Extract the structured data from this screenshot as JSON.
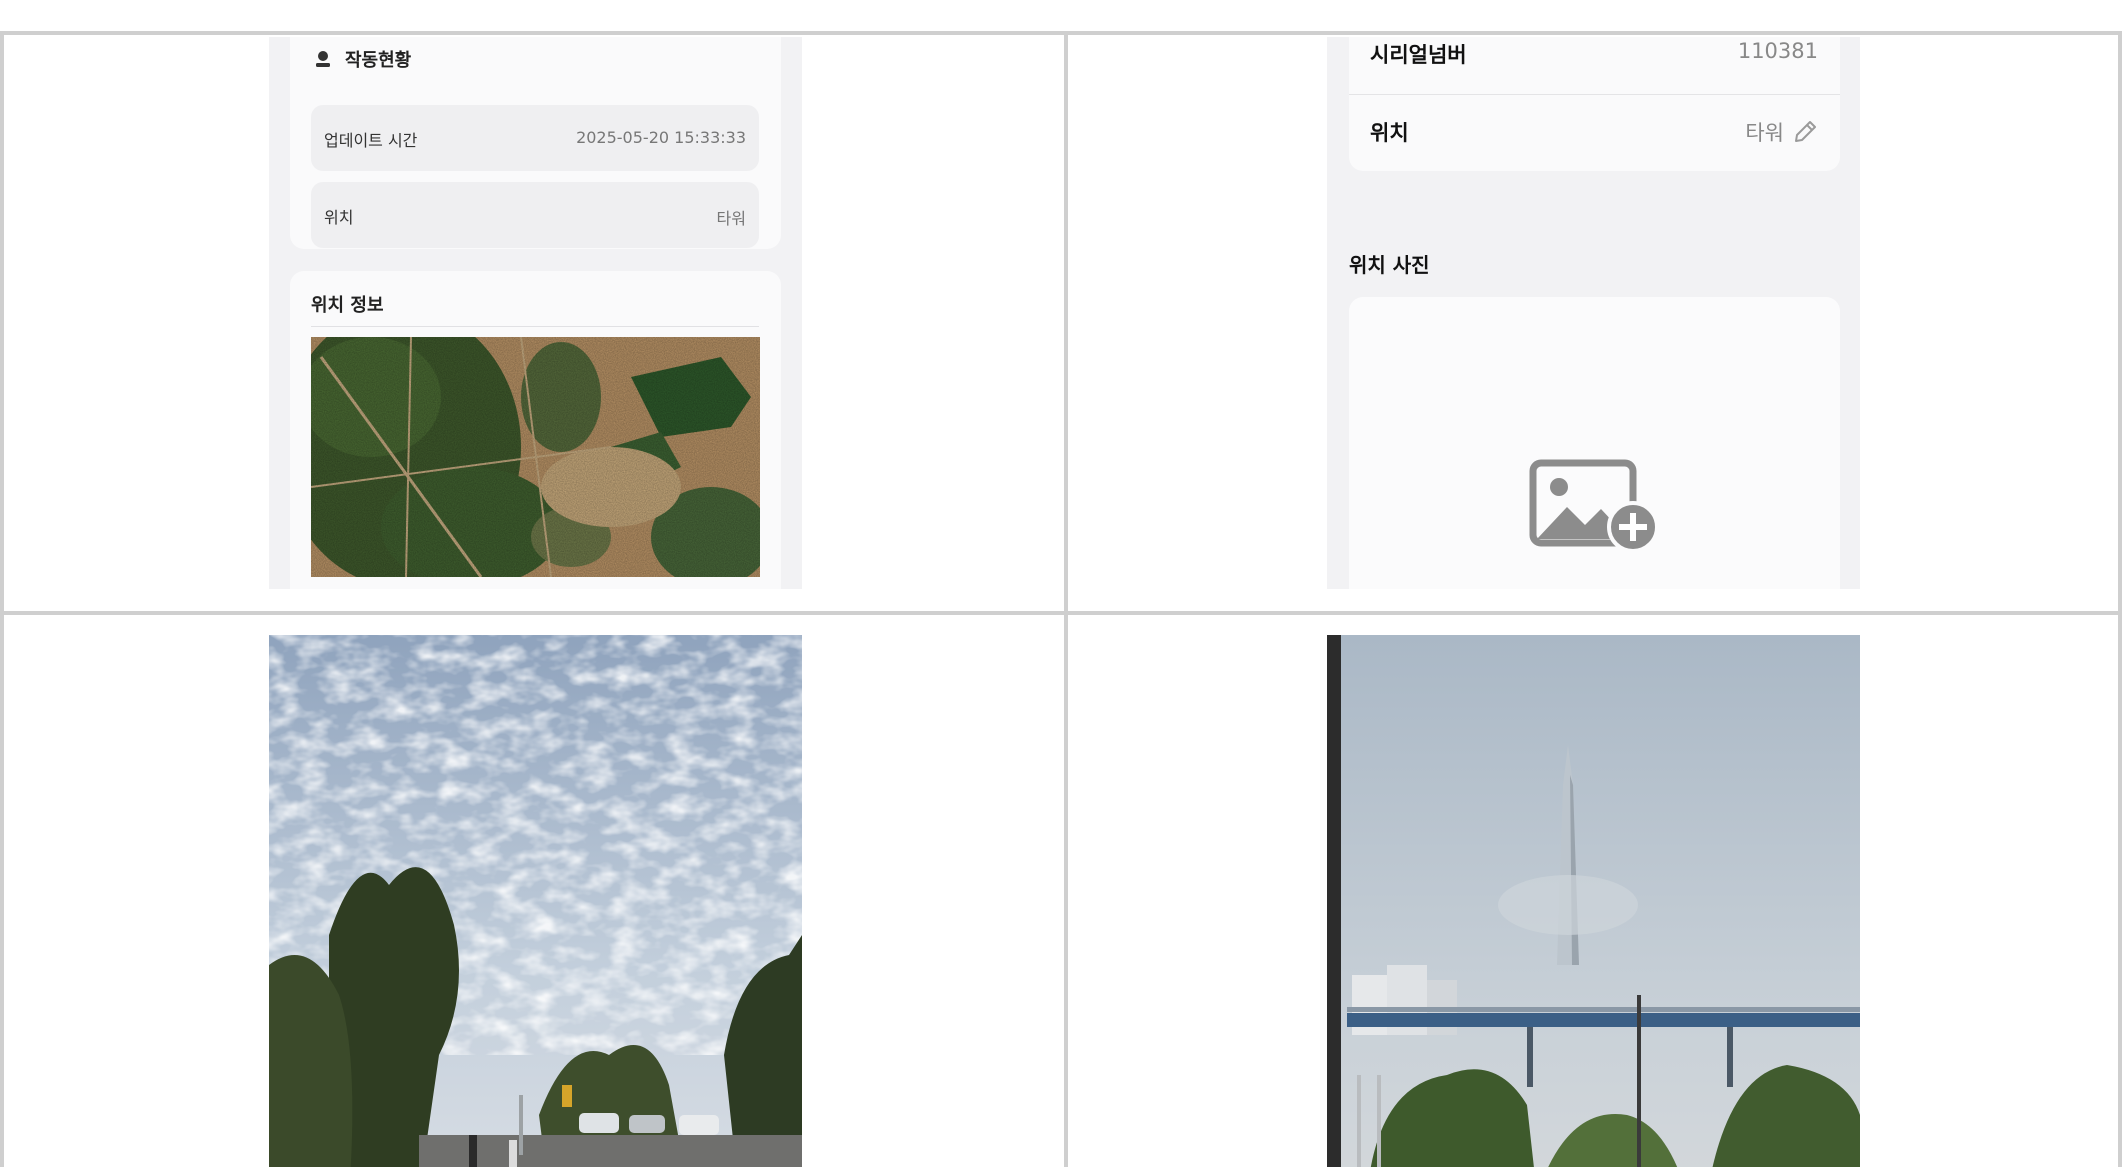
{
  "panel_top_left": {
    "status_section": {
      "title": "작동현황",
      "icon": "person-icon",
      "rows": [
        {
          "label": "업데이트 시간",
          "value": "2025-05-20 15:33:33"
        },
        {
          "label": "위치",
          "value": "타워"
        }
      ]
    },
    "location_info": {
      "title": "위치 정보",
      "image": "satellite-map"
    }
  },
  "panel_top_right": {
    "cut_row": {
      "label": "시리얼넘버",
      "value": "110381"
    },
    "location_row": {
      "label": "위치",
      "value": "타워",
      "edit_icon": "pencil-icon"
    },
    "photo_section": {
      "title": "위치 사진",
      "add_icon": "add-photo-icon"
    }
  },
  "panel_bottom_left": {
    "image": "sky-street-photo"
  },
  "panel_bottom_right": {
    "image": "tower-fog-photo"
  },
  "colors": {
    "grid_line": "#cfcfcf",
    "screen_bg": "#f2f2f4",
    "card_bg": "#fafafb",
    "row_bg": "#efeff1"
  }
}
